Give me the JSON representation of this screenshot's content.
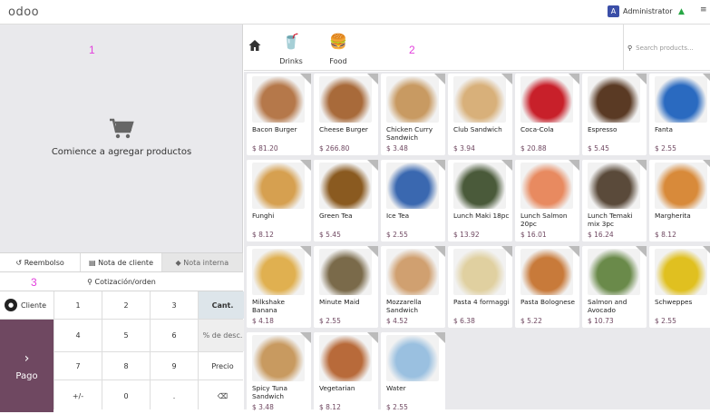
{
  "topbar": {
    "logo": "odoo",
    "user_initial": "A",
    "user": "Administrator",
    "menu_icon": "hamburger-icon"
  },
  "left": {
    "label_1": "1",
    "label_3": "3",
    "empty_message": "Comience a agregar productos",
    "tabs": [
      "Reembolso",
      "Nota de cliente",
      "Nota interna"
    ],
    "quotation": "Cotización/orden",
    "keys": {
      "cliente": "Cliente",
      "pago": "Pago",
      "cant": "Cant.",
      "desc": "% de desc.",
      "precio": "Precio",
      "k1": "1",
      "k2": "2",
      "k3": "3",
      "k4": "4",
      "k5": "5",
      "k6": "6",
      "k7": "7",
      "k8": "8",
      "k9": "9",
      "pm": "+/-",
      "k0": "0",
      "dot": "."
    }
  },
  "right": {
    "label_2": "2",
    "categories": [
      "Drinks",
      "Food"
    ],
    "search_placeholder": "Search products...",
    "products": [
      {
        "name": "Bacon Burger",
        "price": "$ 81.20",
        "color": "#b5784a"
      },
      {
        "name": "Cheese Burger",
        "price": "$ 266.80",
        "color": "#a86a3a"
      },
      {
        "name": "Chicken Curry Sandwich",
        "price": "$ 3.48",
        "color": "#c89a62"
      },
      {
        "name": "Club Sandwich",
        "price": "$ 3.94",
        "color": "#d8b07a"
      },
      {
        "name": "Coca-Cola",
        "price": "$ 20.88",
        "color": "#c8202a"
      },
      {
        "name": "Espresso",
        "price": "$ 5.45",
        "color": "#5a3a24"
      },
      {
        "name": "Fanta",
        "price": "$ 2.55",
        "color": "#2a6ac0"
      },
      {
        "name": "Funghi",
        "price": "$ 8.12",
        "color": "#d6a050"
      },
      {
        "name": "Green Tea",
        "price": "$ 5.45",
        "color": "#8a5a20"
      },
      {
        "name": "Ice Tea",
        "price": "$ 2.55",
        "color": "#3a68b0"
      },
      {
        "name": "Lunch Maki 18pc",
        "price": "$ 13.92",
        "color": "#4a5a3a"
      },
      {
        "name": "Lunch Salmon 20pc",
        "price": "$ 16.01",
        "color": "#e88a60"
      },
      {
        "name": "Lunch Temaki mix 3pc",
        "price": "$ 16.24",
        "color": "#5a4a3a"
      },
      {
        "name": "Margherita",
        "price": "$ 8.12",
        "color": "#d88a3a"
      },
      {
        "name": "Milkshake Banana",
        "price": "$ 4.18",
        "color": "#e0b050"
      },
      {
        "name": "Minute Maid",
        "price": "$ 2.55",
        "color": "#7a6a4a"
      },
      {
        "name": "Mozzarella Sandwich",
        "price": "$ 4.52",
        "color": "#d0a070"
      },
      {
        "name": "Pasta 4 formaggi",
        "price": "$ 6.38",
        "color": "#e0d0a0"
      },
      {
        "name": "Pasta Bolognese",
        "price": "$ 5.22",
        "color": "#c87a3a"
      },
      {
        "name": "Salmon and Avocado",
        "price": "$ 10.73",
        "color": "#6a8a4a"
      },
      {
        "name": "Schweppes",
        "price": "$ 2.55",
        "color": "#e0c020"
      },
      {
        "name": "Spicy Tuna Sandwich",
        "price": "$ 3.48",
        "color": "#c89a60"
      },
      {
        "name": "Vegetarian",
        "price": "$ 8.12",
        "color": "#b86a3a"
      },
      {
        "name": "Water",
        "price": "$ 2.55",
        "color": "#9ac0e0"
      }
    ]
  }
}
